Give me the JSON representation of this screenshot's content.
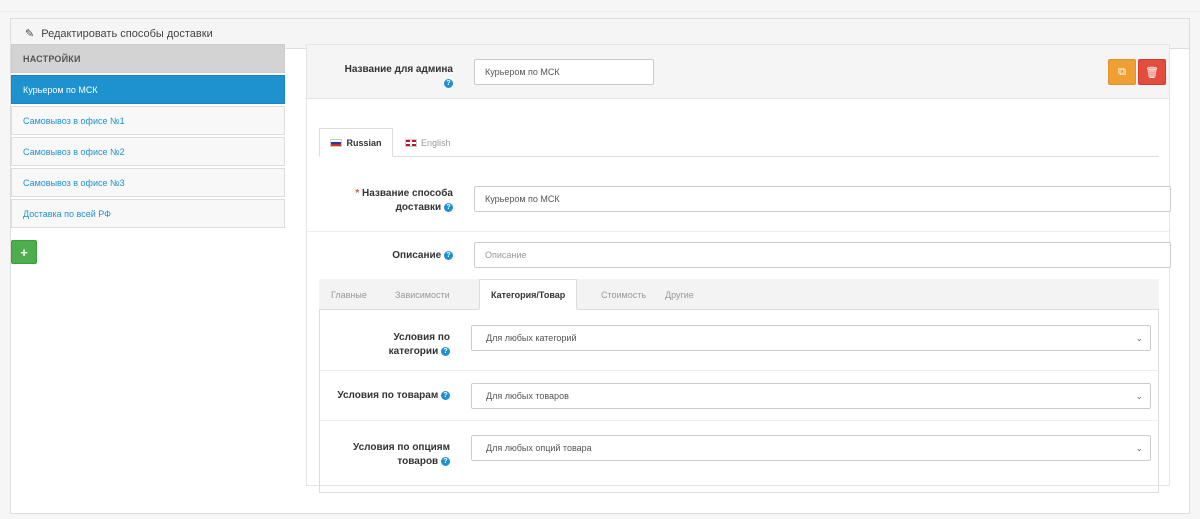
{
  "heading": {
    "title": "Редактировать способы доставки",
    "icon": "pencil-icon"
  },
  "sidebar": {
    "header": "НАСТРОЙКИ",
    "items": [
      {
        "label": "Курьером по МСК",
        "active": true
      },
      {
        "label": "Самовывоз в офисе №1",
        "active": false
      },
      {
        "label": "Самовывоз в офисе №2",
        "active": false
      },
      {
        "label": "Самовывоз в офисе №3",
        "active": false
      },
      {
        "label": "Доставка по всей РФ",
        "active": false
      }
    ],
    "add_label": "+"
  },
  "admin": {
    "label": "Название для админа",
    "value": "Курьером по МСК"
  },
  "actions": {
    "copy_icon": "copy-icon",
    "delete_icon": "trash-icon"
  },
  "lang_tabs": [
    {
      "label": "Russian",
      "active": true
    },
    {
      "label": "English",
      "active": false
    }
  ],
  "form": {
    "name_label_line1": "Название способа",
    "name_label_line2": "доставки",
    "required_mark": "*",
    "name_value": "Курьером по МСК",
    "description_label": "Описание",
    "description_placeholder": "Описание"
  },
  "sub_tabs": [
    {
      "label": "Главные",
      "active": false
    },
    {
      "label": "Зависимости",
      "active": false
    },
    {
      "label": "Категория/Товар",
      "active": true
    },
    {
      "label": "Стоимость",
      "active": false
    },
    {
      "label": "Другие",
      "active": false
    }
  ],
  "conditions": {
    "category": {
      "label_line1": "Условия по",
      "label_line2": "категории",
      "value": "Для любых категорий"
    },
    "products": {
      "label": "Условия по товарам",
      "value": "Для любых товаров"
    },
    "options": {
      "label_line1": "Условия по опциям",
      "label_line2": "товаров",
      "value": "Для любых опций товара"
    }
  },
  "colors": {
    "accent": "#1e91cf",
    "success": "#4cae4c",
    "warning": "#f0a033",
    "danger": "#e44c3e"
  }
}
